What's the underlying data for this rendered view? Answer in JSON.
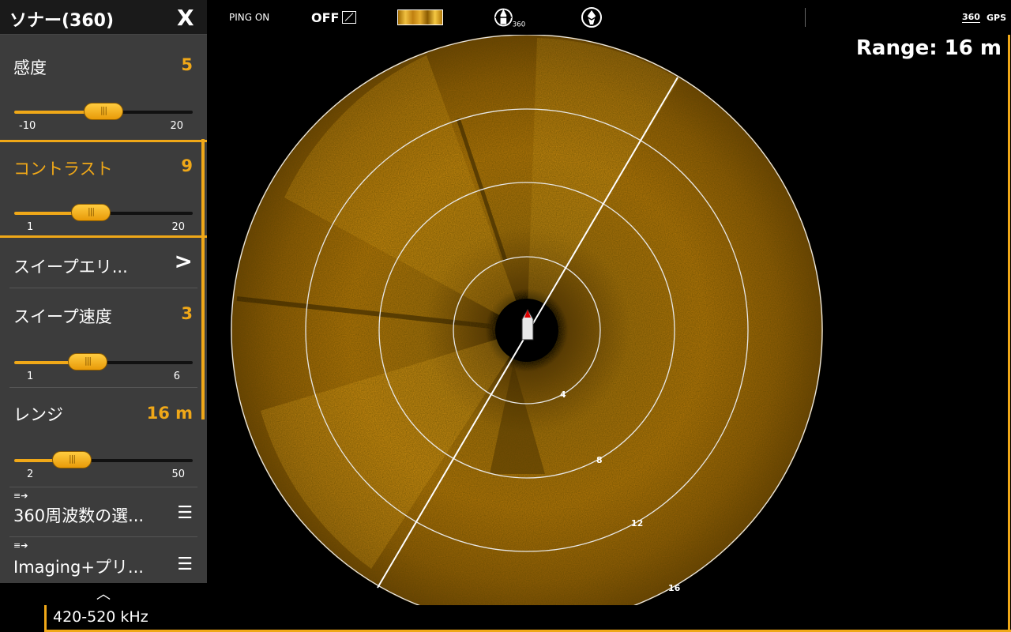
{
  "panel": {
    "title": "ソナー(360)",
    "close_label": "X",
    "sensitivity": {
      "label": "感度",
      "value": "5",
      "min": "-10",
      "max": "20",
      "fraction": 0.5
    },
    "contrast": {
      "label": "コントラスト",
      "value": "9",
      "min": "1",
      "max": "20",
      "fraction": 0.42
    },
    "sweep_area": {
      "label": "スイープエリ...",
      "chevron": ">"
    },
    "sweep_speed": {
      "label": "スイープ速度",
      "value": "3",
      "min": "1",
      "max": "6",
      "fraction": 0.4
    },
    "range": {
      "label": "レンジ",
      "value": "16 m",
      "min": "2",
      "max": "50",
      "fraction": 0.29
    },
    "freq_select": {
      "label": "360周波数の選...",
      "icon": "list-menu-icon"
    },
    "imaging_preset": {
      "label": "Imaging+プリ...",
      "icon": "list-menu-icon"
    },
    "collapse": "︿"
  },
  "toolbar": {
    "ping": "PING ON",
    "off": "OFF",
    "icon_360": "360",
    "gps": "GPS"
  },
  "view": {
    "range_text": "Range: 16 m",
    "frequency": "420-520 kHz",
    "ring_labels": [
      "4",
      "8",
      "12",
      "16"
    ]
  },
  "colors": {
    "accent": "#f0a818",
    "sonar": "#c88a10",
    "background": "#000000"
  }
}
